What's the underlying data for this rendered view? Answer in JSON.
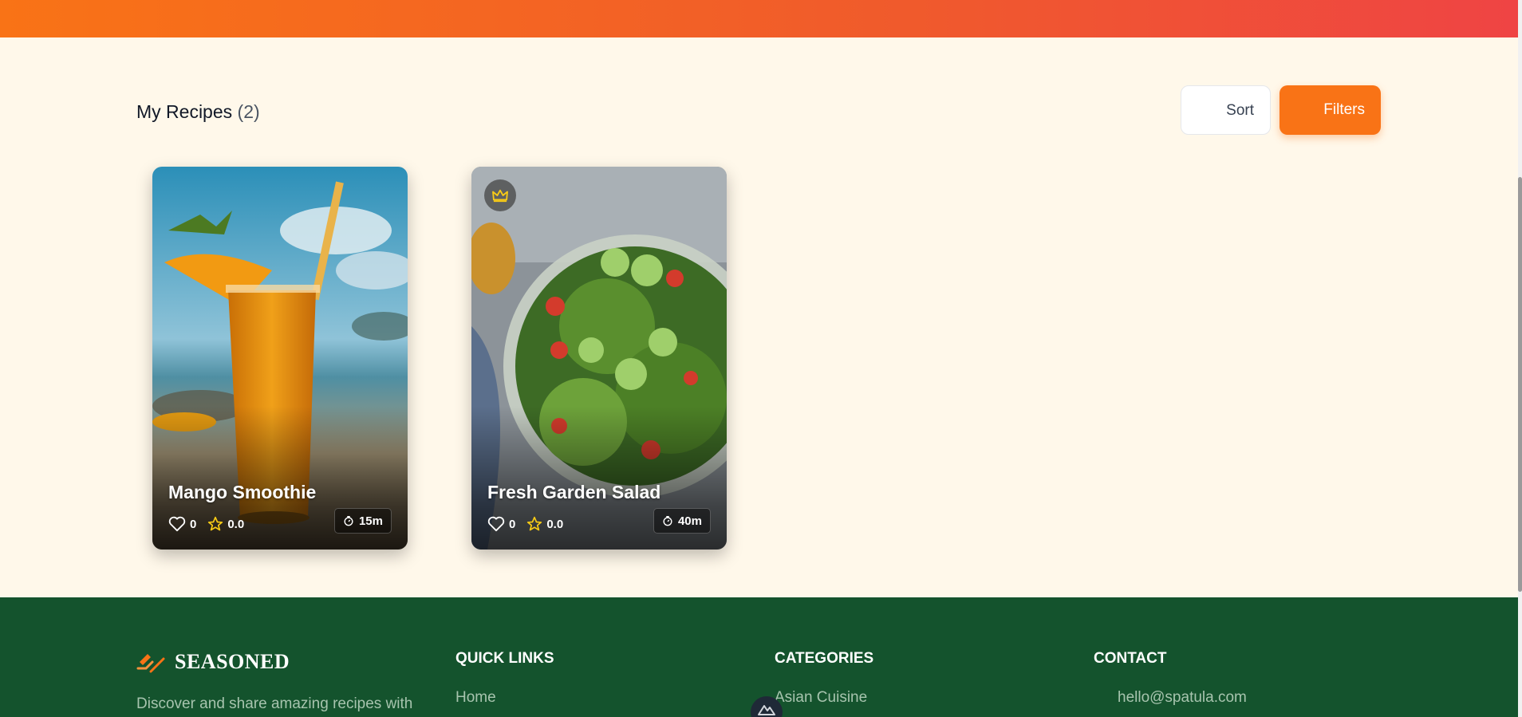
{
  "header": {
    "gradient_from": "#f97316",
    "gradient_to": "#ef4444"
  },
  "recipes_section": {
    "title": "My Recipes",
    "count": "(2)",
    "sort_label": "Sort",
    "filters_label": "Filters"
  },
  "recipes": [
    {
      "title": "Mango Smoothie",
      "likes": "0",
      "rating": "0.0",
      "time": "15m",
      "premium": false,
      "image": "mango-smoothie-photo"
    },
    {
      "title": "Fresh Garden Salad",
      "likes": "0",
      "rating": "0.0",
      "time": "40m",
      "premium": true,
      "image": "garden-salad-photo"
    }
  ],
  "footer": {
    "brand": "SEASONED",
    "description": "Discover and share amazing recipes with",
    "quick_links": {
      "heading": "QUICK LINKS",
      "items": [
        "Home"
      ]
    },
    "categories": {
      "heading": "CATEGORIES",
      "items": [
        "Asian Cuisine"
      ]
    },
    "contact": {
      "heading": "CONTACT",
      "email": "hello@spatula.com"
    }
  },
  "colors": {
    "accent": "#f97316",
    "footer_bg": "#14532d",
    "page_bg": "#fff8ea"
  }
}
